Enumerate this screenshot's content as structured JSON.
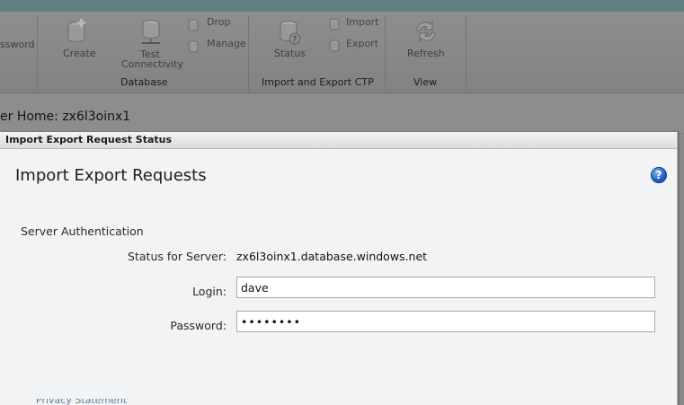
{
  "ribbon": {
    "buttons": {
      "password": "ssword",
      "create": "Create",
      "test_connectivity_line1": "Test",
      "test_connectivity_line2": "Connectivity",
      "drop": "Drop",
      "manage": "Manage",
      "status": "Status",
      "import": "Import",
      "export": "Export",
      "refresh": "Refresh"
    },
    "groups": {
      "database": "Database",
      "import_export": "Import and Export CTP",
      "view": "View"
    }
  },
  "server_home": "er Home:  zx6l3oinx1",
  "dialog": {
    "title": "Import Export Request Status",
    "heading": "Import Export Requests",
    "help_glyph": "?",
    "section": "Server Authentication",
    "status_label": "Status for Server:",
    "status_value": "zx6l3oinx1.database.windows.net",
    "login_label": "Login:",
    "login_value": "dave",
    "password_label": "Password:",
    "password_value": "••••••••"
  },
  "icons": [
    "database-create-icon",
    "test-connectivity-icon",
    "drop-icon",
    "manage-icon",
    "status-icon",
    "import-icon",
    "export-icon",
    "refresh-icon",
    "help-icon"
  ]
}
